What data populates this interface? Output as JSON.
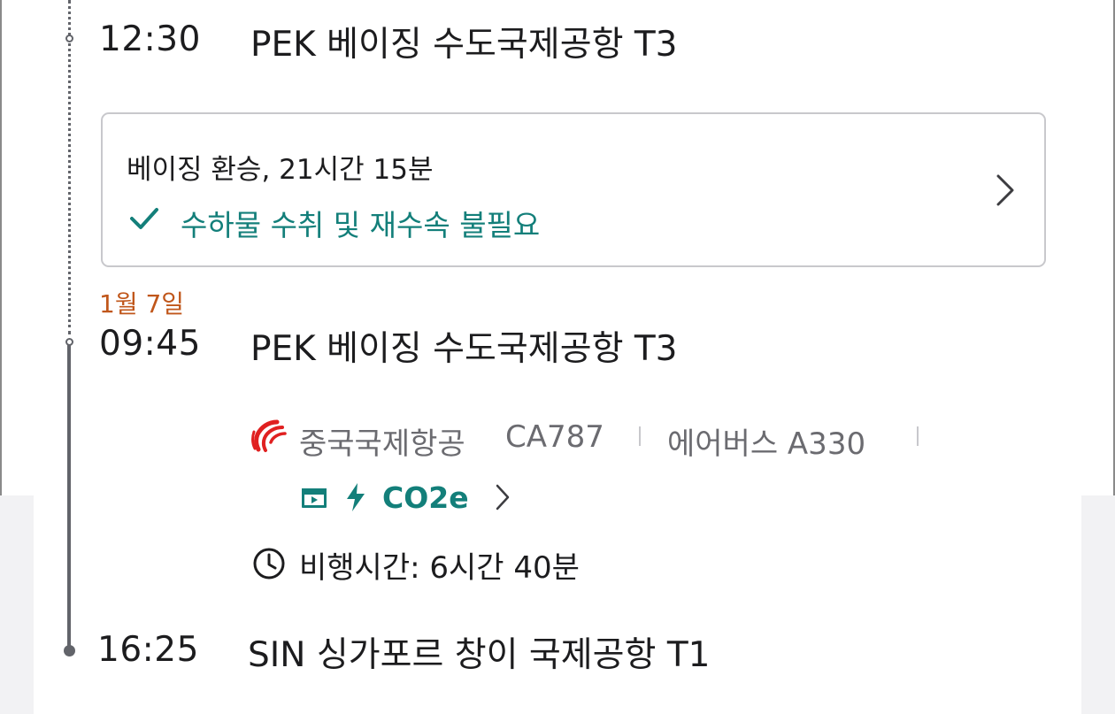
{
  "itinerary": {
    "arrival_transfer": {
      "time": "12:30",
      "airport": "PEK 베이징 수도국제공항 T3"
    },
    "connection": {
      "title": "베이징 환승, 21시간 15분",
      "note": "수하물 수취 및 재수속 불필요",
      "check_icon": "check-icon",
      "chevron_icon": "chevron-right-icon"
    },
    "next_date": "1월 7일",
    "departure": {
      "time": "09:45",
      "airport": "PEK 베이징 수도국제공항 T3"
    },
    "flight": {
      "airline": "중국국제항공",
      "flight_number": "CA787",
      "aircraft": "에어버스 A330",
      "amenities": [
        "entertainment-icon",
        "power-icon"
      ],
      "co2_label": "CO2e",
      "duration": "비행시간: 6시간 40분"
    },
    "arrival_final": {
      "time": "16:25",
      "airport": "SIN 싱가포르 창이 국제공항 T1"
    }
  },
  "colors": {
    "accent_teal": "#137f7a",
    "date_orange": "#c0561a",
    "airline_red": "#e02020",
    "timeline_gray": "#62646a"
  }
}
